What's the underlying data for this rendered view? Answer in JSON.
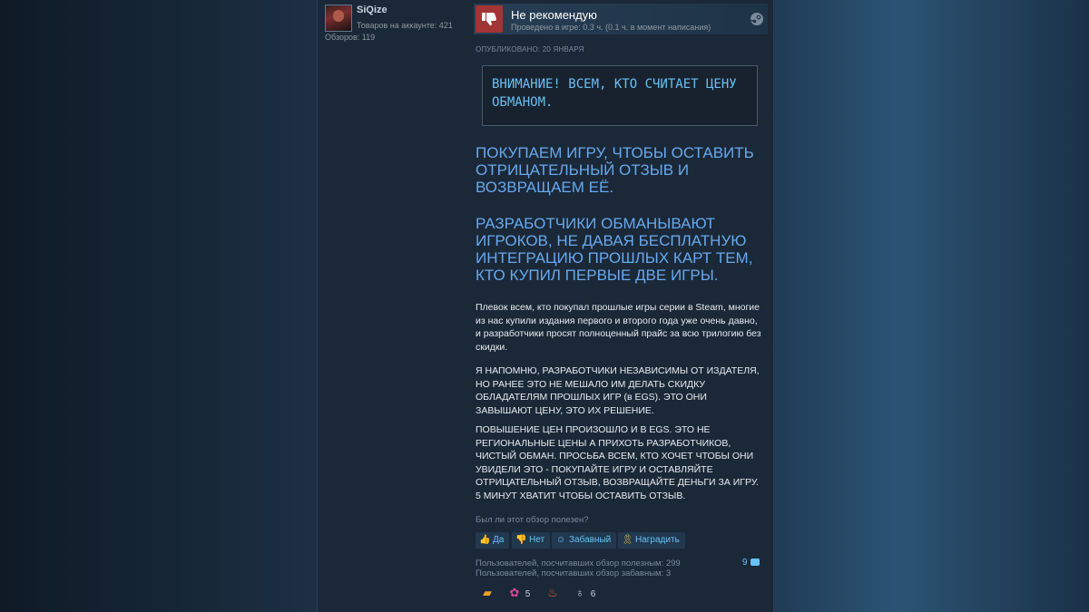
{
  "author": {
    "name": "SiQize",
    "products": "Товаров на аккаунте: 421",
    "reviews": "Обзоров: 119"
  },
  "review": {
    "verdict": "Не рекомендую",
    "playtime": "Проведено в игре: 0.3 ч. (0.1 ч. в момент написания)",
    "posted": "ОПУБЛИКОВАНО: 20 ЯНВАРЯ",
    "notice": "ВНИМАНИЕ! ВСЕМ, КТО СЧИТАЕТ ЦЕНУ ОБМАНОМ.",
    "heading1": "ПОКУПАЕМ ИГРУ, ЧТОБЫ ОСТАВИТЬ ОТРИЦАТЕЛЬНЫЙ ОТЗЫВ И ВОЗВРАЩАЕМ ЕЁ.",
    "heading2": "РАЗРАБОТЧИКИ ОБМАНЫВАЮТ ИГРОКОВ, НЕ ДАВАЯ БЕСПЛАТНУЮ ИНТЕГРАЦИЮ ПРОШЛЫХ КАРТ ТЕМ, КТО КУПИЛ ПЕРВЫЕ ДВЕ ИГРЫ.",
    "paragraph1": "Плевок всем, кто покупал прошлые игры серии в Steam, многие из нас купили издания первого и второго года уже очень давно, и разработчики просят полноценный прайс за всю трилогию без скидки.",
    "paragraph2": "Я НАПОМНЮ, РАЗРАБОТЧИКИ НЕЗАВИСИМЫ ОТ ИЗДАТЕЛЯ, НО РАНЕЕ ЭТО НЕ МЕШАЛО ИМ ДЕЛАТЬ СКИДКУ ОБЛАДАТЕЛЯМ ПРОШЛЫХ ИГР (в EGS). ЭТО ОНИ ЗАВЫШАЮТ ЦЕНУ, ЭТО ИХ РЕШЕНИЕ.",
    "paragraph3": "ПОВЫШЕНИЕ ЦЕН ПРОИЗОШЛО И В EGS. ЭТО НЕ РЕГИОНАЛЬНЫЕ ЦЕНЫ А ПРИХОТЬ РАЗРАБОТЧИКОВ, ЧИСТЫЙ ОБМАН. ПРОСЬБА ВСЕМ, КТО ХОЧЕТ ЧТОБЫ ОНИ УВИДЕЛИ ЭТО - ПОКУПАЙТЕ ИГРУ И ОСТАВЛЯЙТЕ ОТРИЦАТЕЛЬНЫЙ ОТЗЫВ, ВОЗВРАЩАЙТЕ ДЕНЬГИ ЗА ИГРУ. 5 МИНУТ ХВАТИТ ЧТОБЫ ОСТАВИТЬ ОТЗЫВ."
  },
  "feedback": {
    "question": "Был ли этот обзор полезен?",
    "yes": "Да",
    "no": "Нет",
    "funny": "Забавный",
    "award": "Наградить",
    "helpful_stat": "Пользователей, посчитавших обзор полезным: 299",
    "funny_stat": "Пользователей, посчитавших обзор забавным: 3",
    "comments_count": "9"
  },
  "awards": [
    {
      "icon": "gun-award-icon",
      "count": ""
    },
    {
      "icon": "clown-award-icon",
      "count": "5"
    },
    {
      "icon": "fire-award-icon",
      "count": ""
    },
    {
      "icon": "medal-award-icon",
      "count": "6"
    }
  ],
  "colors": {
    "thumb_down_bg": "#a33434",
    "link": "#67c1f5",
    "heading": "#67a9ee",
    "card_bg": "#1b2838"
  }
}
